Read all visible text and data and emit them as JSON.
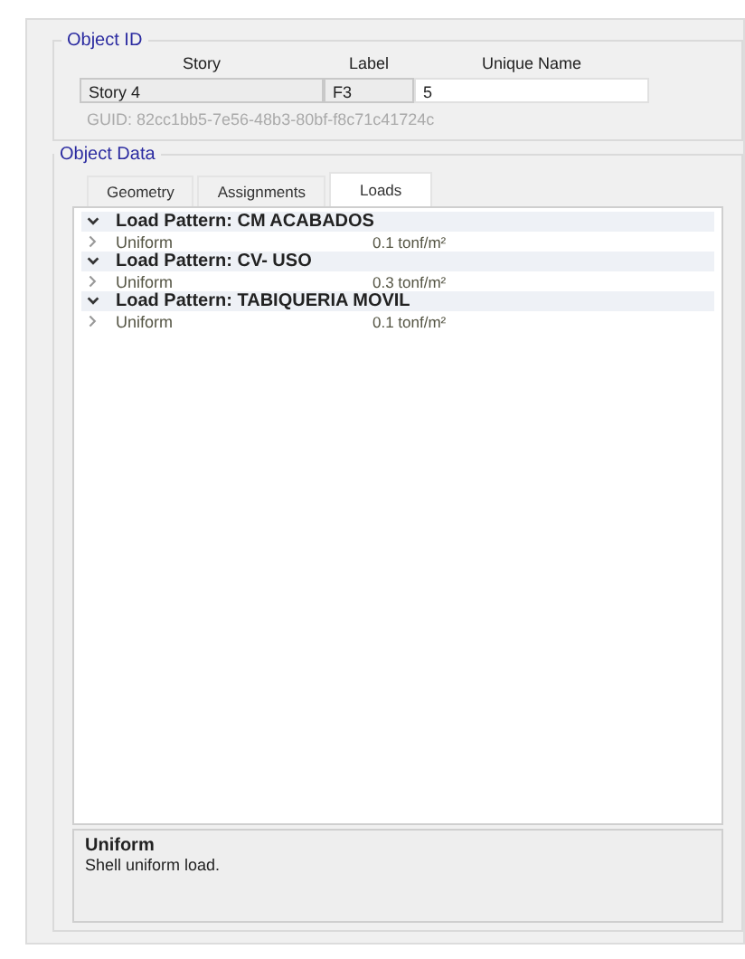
{
  "object_id": {
    "title": "Object ID",
    "columns": [
      "Story",
      "Label",
      "Unique Name"
    ],
    "values": [
      {
        "text": "Story 4",
        "editable": false
      },
      {
        "text": "F3",
        "editable": false
      },
      {
        "text": "5",
        "editable": true
      }
    ],
    "guid": "GUID:  82cc1bb5-7e56-48b3-80bf-f8c71c41724c"
  },
  "object_data": {
    "title": "Object Data",
    "tabs": [
      {
        "label": "Geometry",
        "selected": false
      },
      {
        "label": "Assignments",
        "selected": false
      },
      {
        "label": "Loads",
        "selected": true
      }
    ],
    "patterns": [
      {
        "title": "Load Pattern: CM ACABADOS",
        "expanded": true,
        "items": [
          {
            "name": "Uniform",
            "value": "0.1 tonf/m²",
            "expanded": false
          }
        ]
      },
      {
        "title": "Load Pattern: CV- USO",
        "expanded": true,
        "items": [
          {
            "name": "Uniform",
            "value": "0.3 tonf/m²",
            "expanded": false
          }
        ]
      },
      {
        "title": "Load Pattern: TABIQUERIA MOVIL",
        "expanded": true,
        "items": [
          {
            "name": "Uniform",
            "value": "0.1 tonf/m²",
            "expanded": false
          }
        ]
      }
    ],
    "description": {
      "title": "Uniform",
      "text": "Shell uniform load."
    }
  }
}
